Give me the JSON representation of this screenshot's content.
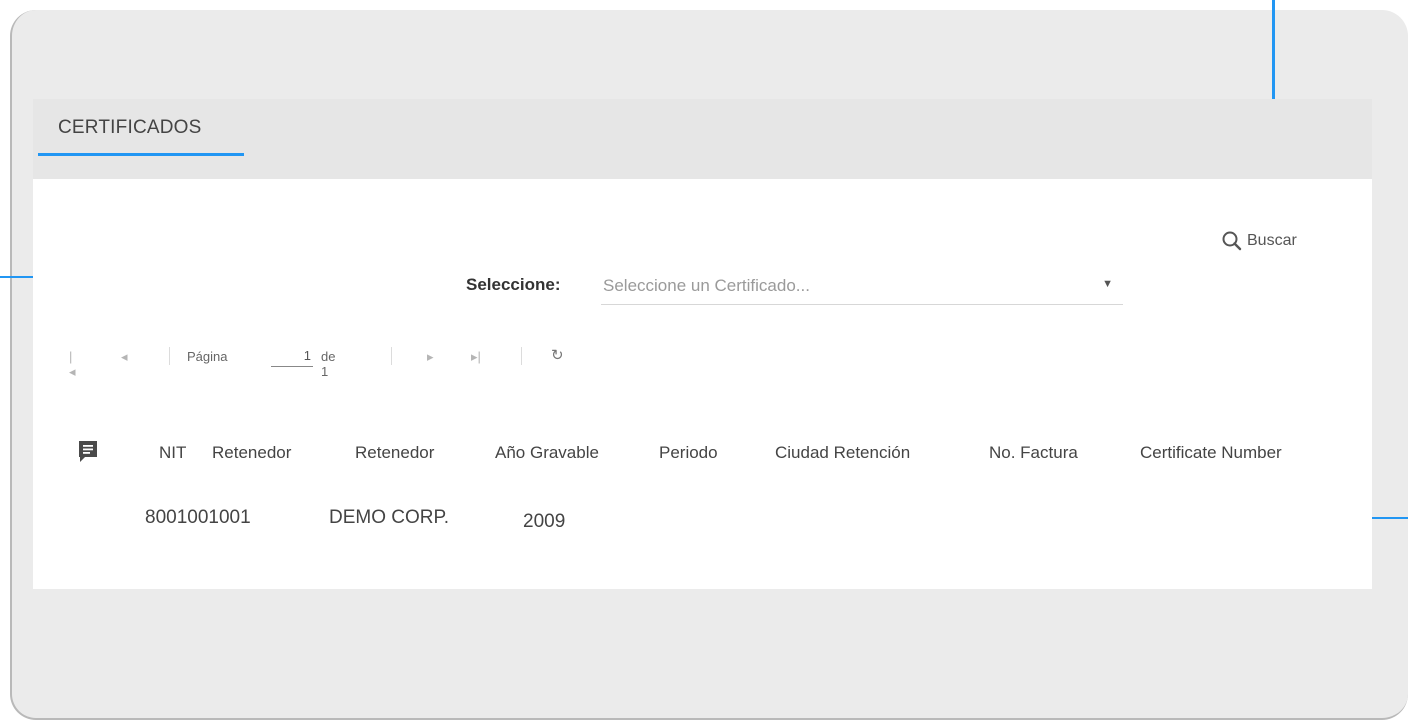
{
  "tab": {
    "label": "CERTIFICADOS"
  },
  "search": {
    "label": "Buscar",
    "icon": "search-icon"
  },
  "selector": {
    "label": "Seleccione:",
    "placeholder": "Seleccione un Certificado...",
    "arrow": "▼"
  },
  "pager": {
    "first": "|◂",
    "prev": "◂",
    "page_label": "Página",
    "page_value": "1",
    "of_label": "de 1",
    "next": "▸",
    "last": "▸|",
    "refresh": "↻"
  },
  "table": {
    "columns": [
      "NIT",
      "Retenedor",
      "Retenedor",
      "Año Gravable",
      "Periodo",
      "Ciudad Retención",
      "No. Factura",
      "Certificate Number"
    ],
    "rows": [
      {
        "nit": "8001001001",
        "retenedor": "DEMO CORP.",
        "anio": "2009"
      }
    ]
  },
  "colors": {
    "accent": "#2196f3",
    "frame": "#ebebeb",
    "panel": "#ffffff"
  }
}
